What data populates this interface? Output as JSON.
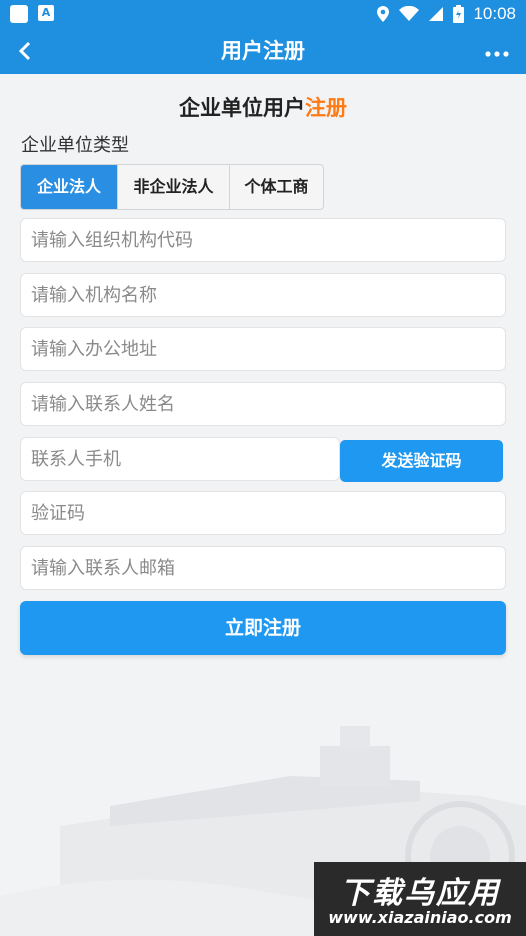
{
  "status_bar": {
    "time": "10:08"
  },
  "app_bar": {
    "title": "用户注册"
  },
  "form": {
    "heading_main": "企业单位用户",
    "heading_accent": "注册",
    "type_label": "企业单位类型",
    "type_options": [
      "企业法人",
      "非企业法人",
      "个体工商"
    ],
    "selected_type": "企业法人",
    "org_code_placeholder": "请输入组织机构代码",
    "org_name_placeholder": "请输入机构名称",
    "address_placeholder": "请输入办公地址",
    "contact_name_placeholder": "请输入联系人姓名",
    "phone_placeholder": "联系人手机",
    "send_code_label": "发送验证码",
    "code_placeholder": "验证码",
    "email_placeholder": "请输入联系人邮箱",
    "submit_label": "立即注册"
  },
  "watermark": {
    "title": "下载乌应用",
    "url": "www.xiazainiao.com"
  },
  "colors": {
    "primary": "#1f8fe0",
    "accent": "#ff7a12",
    "button": "#1e98f0"
  }
}
